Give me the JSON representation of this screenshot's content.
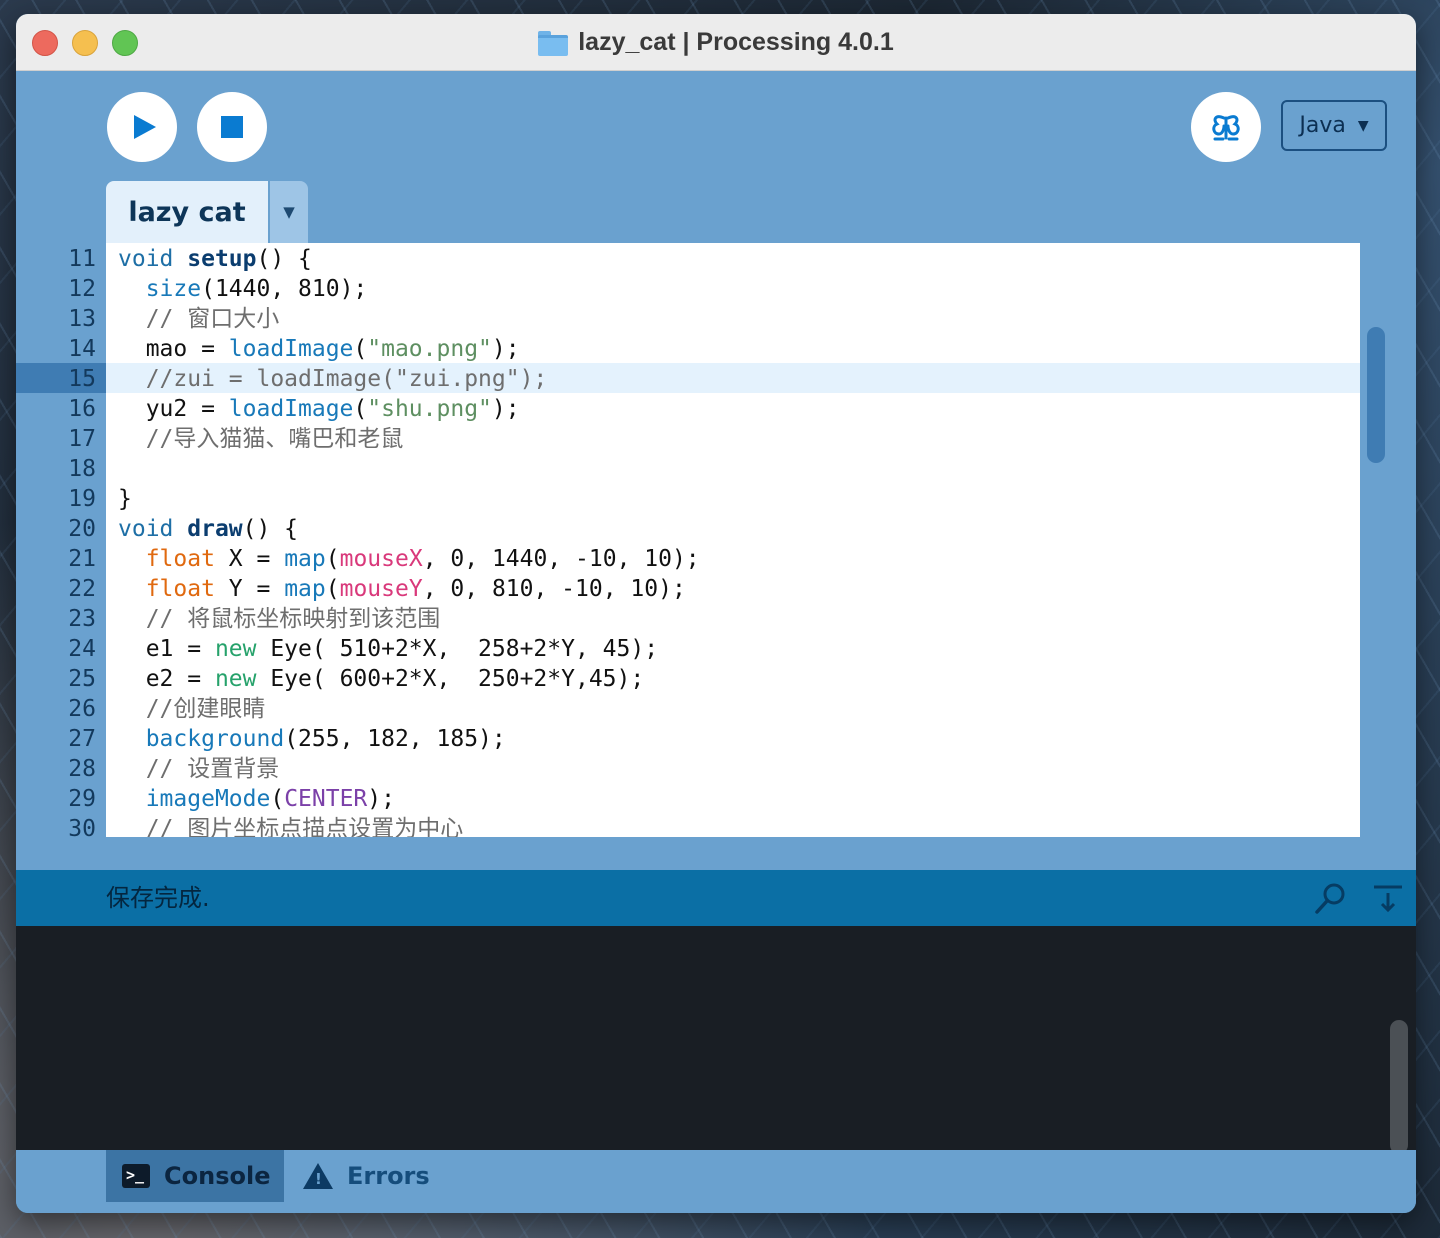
{
  "window": {
    "title": "lazy_cat | Processing 4.0.1"
  },
  "toolbar": {
    "run_icon": "play-icon",
    "stop_icon": "stop-icon",
    "debug_icon": "butterfly-icon",
    "mode": "Java"
  },
  "tabs": [
    {
      "label": "lazy cat"
    }
  ],
  "editor": {
    "current_line": 15,
    "lines": [
      {
        "n": "11",
        "text": "void setup() {"
      },
      {
        "n": "12",
        "text": "  size(1440, 810);"
      },
      {
        "n": "13",
        "text": "  // 窗口大小"
      },
      {
        "n": "14",
        "text": "  mao = loadImage(\"mao.png\");"
      },
      {
        "n": "15",
        "text": "  //zui = loadImage(\"zui.png\");"
      },
      {
        "n": "16",
        "text": "  yu2 = loadImage(\"shu.png\");"
      },
      {
        "n": "17",
        "text": "  //导入猫猫、嘴巴和老鼠"
      },
      {
        "n": "18",
        "text": ""
      },
      {
        "n": "19",
        "text": "}"
      },
      {
        "n": "20",
        "text": "void draw() {"
      },
      {
        "n": "21",
        "text": "  float X = map(mouseX, 0, 1440, -10, 10);"
      },
      {
        "n": "22",
        "text": "  float Y = map(mouseY, 0, 810, -10, 10);"
      },
      {
        "n": "23",
        "text": "  // 将鼠标坐标映射到该范围"
      },
      {
        "n": "24",
        "text": "  e1 = new Eye( 510+2*X,  258+2*Y, 45);"
      },
      {
        "n": "25",
        "text": "  e2 = new Eye( 600+2*X,  250+2*Y,45);"
      },
      {
        "n": "26",
        "text": "  //创建眼睛"
      },
      {
        "n": "27",
        "text": "  background(255, 182, 185);"
      },
      {
        "n": "28",
        "text": "  // 设置背景"
      },
      {
        "n": "29",
        "text": "  imageMode(CENTER);"
      },
      {
        "n": "30",
        "text": "  // 图片坐标点描点设置为中心"
      }
    ]
  },
  "status": {
    "message": "保存完成."
  },
  "bottom_tabs": [
    {
      "label": "Console",
      "icon": "terminal-icon"
    },
    {
      "label": "Errors",
      "icon": "warning-icon"
    }
  ],
  "colors": {
    "chrome": "#6aa1cf",
    "status_bar": "#0b6fa5",
    "console_bg": "#191e24",
    "accent": "#0a7bd1"
  }
}
